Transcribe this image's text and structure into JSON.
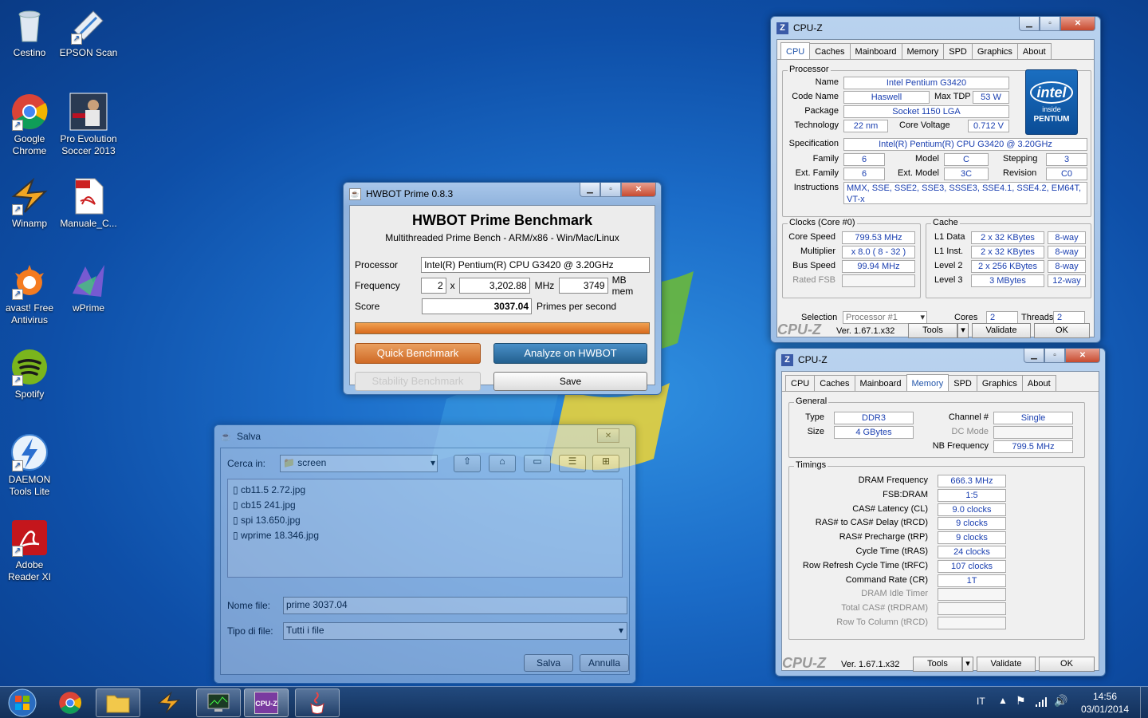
{
  "desktop": {
    "icons": [
      {
        "label": "Cestino"
      },
      {
        "label": "EPSON Scan"
      },
      {
        "label": "Google Chrome"
      },
      {
        "label": "Pro Evolution Soccer 2013"
      },
      {
        "label": "Winamp"
      },
      {
        "label": "Manuale_C..."
      },
      {
        "label": "avast! Free Antivirus"
      },
      {
        "label": "wPrime"
      },
      {
        "label": "Spotify"
      },
      {
        "label": "DAEMON Tools Lite"
      },
      {
        "label": "Adobe Reader XI"
      }
    ]
  },
  "hwbot": {
    "window_title": "HWBOT Prime 0.8.3",
    "heading": "HWBOT Prime Benchmark",
    "subheading": "Multithreaded Prime Bench - ARM/x86 - Win/Mac/Linux",
    "processor_label": "Processor",
    "processor_value": "Intel(R) Pentium(R) CPU G3420 @ 3.20GHz",
    "frequency_label": "Frequency",
    "freq_mult": "2",
    "freq_x": "x",
    "freq_mhz": "3,202.88",
    "mhz_unit": "MHz",
    "mem_value": "3749",
    "mem_unit": "MB mem",
    "score_label": "Score",
    "score_value": "3037.04",
    "score_unit": "Primes per second",
    "progress": 1.0,
    "quick_button": "Quick Benchmark",
    "analyze_button": "Analyze on HWBOT",
    "stability_button": "Stability Benchmark",
    "save_button": "Save"
  },
  "save_dialog": {
    "title": "Salva",
    "look_in_label": "Cerca in:",
    "look_in_value": "screen",
    "files": [
      {
        "name": "cb11.5 2.72.jpg"
      },
      {
        "name": "cb15 241.jpg"
      },
      {
        "name": "spi 13.650.jpg"
      },
      {
        "name": "wprime 18.346.jpg"
      }
    ],
    "filename_label": "Nome file:",
    "filename_value": "prime 3037.04",
    "filetype_label": "Tipo di file:",
    "filetype_value": "Tutti i file",
    "save_button": "Salva",
    "cancel_button": "Annulla"
  },
  "cpuz_cpu": {
    "title": "CPU-Z",
    "tabs": [
      "CPU",
      "Caches",
      "Mainboard",
      "Memory",
      "SPD",
      "Graphics",
      "About"
    ],
    "active_tab": "CPU",
    "processor_group": "Processor",
    "name_label": "Name",
    "name": "Intel Pentium G3420",
    "codename_label": "Code Name",
    "codename": "Haswell",
    "maxtdp_label": "Max TDP",
    "maxtdp": "53 W",
    "package_label": "Package",
    "package": "Socket 1150 LGA",
    "technology_label": "Technology",
    "technology": "22 nm",
    "voltage_label": "Core Voltage",
    "voltage": "0.712 V",
    "spec_label": "Specification",
    "spec": "Intel(R) Pentium(R) CPU G3420 @ 3.20GHz",
    "family_label": "Family",
    "family": "6",
    "model_label": "Model",
    "model": "C",
    "stepping_label": "Stepping",
    "stepping": "3",
    "extfamily_label": "Ext. Family",
    "extfamily": "6",
    "extmodel_label": "Ext. Model",
    "extmodel": "3C",
    "revision_label": "Revision",
    "revision": "C0",
    "instr_label": "Instructions",
    "instructions": "MMX, SSE, SSE2, SSE3, SSSE3, SSE4.1, SSE4.2, EM64T, VT-x",
    "clocks_group": "Clocks (Core #0)",
    "corespeed_label": "Core Speed",
    "corespeed": "799.53 MHz",
    "multiplier_label": "Multiplier",
    "multiplier": "x 8.0 ( 8 - 32 )",
    "busspeed_label": "Bus Speed",
    "busspeed": "99.94 MHz",
    "ratedfsb_label": "Rated FSB",
    "cache_group": "Cache",
    "l1d_label": "L1 Data",
    "l1d": "2 x 32 KBytes",
    "l1d_way": "8-way",
    "l1i_label": "L1 Inst.",
    "l1i": "2 x 32 KBytes",
    "l1i_way": "8-way",
    "l2_label": "Level 2",
    "l2": "2 x 256 KBytes",
    "l2_way": "8-way",
    "l3_label": "Level 3",
    "l3": "3 MBytes",
    "l3_way": "12-way",
    "selection_label": "Selection",
    "selection": "Processor #1",
    "cores_label": "Cores",
    "cores": "2",
    "threads_label": "Threads",
    "threads": "2",
    "intel_logo": {
      "brand": "intel",
      "inside": "inside",
      "product": "PENTIUM"
    },
    "footer": {
      "logo": "CPU-Z",
      "version": "Ver. 1.67.1.x32",
      "tools": "Tools",
      "validate": "Validate",
      "ok": "OK"
    }
  },
  "cpuz_mem": {
    "title": "CPU-Z",
    "tabs": [
      "CPU",
      "Caches",
      "Mainboard",
      "Memory",
      "SPD",
      "Graphics",
      "About"
    ],
    "active_tab": "Memory",
    "general_group": "General",
    "type_label": "Type",
    "type": "DDR3",
    "size_label": "Size",
    "size": "4 GBytes",
    "channel_label": "Channel #",
    "channel": "Single",
    "dcmode_label": "DC Mode",
    "nbfreq_label": "NB Frequency",
    "nbfreq": "799.5 MHz",
    "timings_group": "Timings",
    "timings": [
      {
        "label": "DRAM Frequency",
        "value": "666.3 MHz"
      },
      {
        "label": "FSB:DRAM",
        "value": "1:5"
      },
      {
        "label": "CAS# Latency (CL)",
        "value": "9.0 clocks"
      },
      {
        "label": "RAS# to CAS# Delay (tRCD)",
        "value": "9 clocks"
      },
      {
        "label": "RAS# Precharge (tRP)",
        "value": "9 clocks"
      },
      {
        "label": "Cycle Time (tRAS)",
        "value": "24 clocks"
      },
      {
        "label": "Row Refresh Cycle Time (tRFC)",
        "value": "107 clocks"
      },
      {
        "label": "Command Rate (CR)",
        "value": "1T"
      },
      {
        "label": "DRAM Idle Timer",
        "value": ""
      },
      {
        "label": "Total CAS# (tRDRAM)",
        "value": ""
      },
      {
        "label": "Row To Column (tRCD)",
        "value": ""
      }
    ],
    "footer": {
      "logo": "CPU-Z",
      "version": "Ver. 1.67.1.x32",
      "tools": "Tools",
      "validate": "Validate",
      "ok": "OK"
    }
  },
  "taskbar": {
    "language": "IT",
    "time": "14:56",
    "date": "03/01/2014",
    "items": [
      "start",
      "chrome",
      "explorer",
      "winamp",
      "task-manager",
      "cpu-z",
      "java"
    ]
  },
  "colors": {
    "accent_orange": "#e07a30",
    "accent_blue": "#2e6fa8",
    "cpuz_value": "#1a3fb0"
  }
}
